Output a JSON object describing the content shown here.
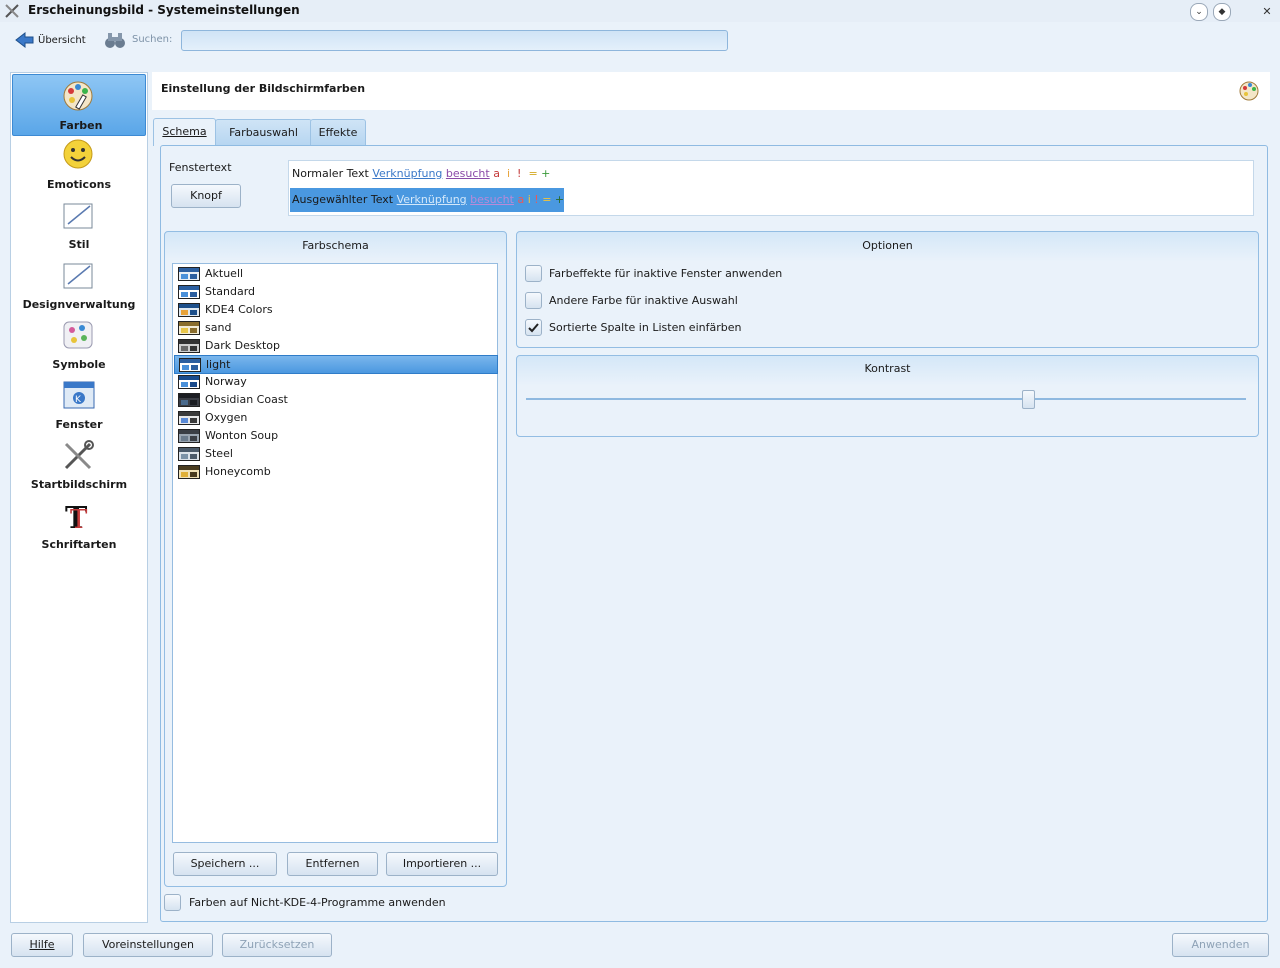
{
  "window": {
    "title": "Erscheinungsbild - Systemeinstellungen",
    "buttons": [
      "⌄",
      "◆",
      "✕"
    ]
  },
  "toolbar": {
    "back_label": "Übersicht",
    "search_label": "Suchen:",
    "search_value": ""
  },
  "sidebar": {
    "items": [
      {
        "label": "Farben",
        "icon": "palette-icon",
        "active": true
      },
      {
        "label": "Emoticons",
        "icon": "smiley-icon"
      },
      {
        "label": "Stil",
        "icon": "style-icon"
      },
      {
        "label": "Designverwaltung",
        "icon": "theme-icon"
      },
      {
        "label": "Symbole",
        "icon": "icons-icon"
      },
      {
        "label": "Fenster",
        "icon": "window-icon"
      },
      {
        "label": "Startbildschirm",
        "icon": "tools-icon"
      },
      {
        "label": "Schriftarten",
        "icon": "font-icon"
      }
    ]
  },
  "main": {
    "header_title": "Einstellung der Bildschirmfarben",
    "tabs": [
      {
        "label": "Schema",
        "active": true
      },
      {
        "label": "Farbauswahl"
      },
      {
        "label": "Effekte"
      }
    ],
    "preview": {
      "window_text": "Fenstertext",
      "button_label": "Knopf",
      "normal_text": "Normaler Text",
      "selected_text": "Ausgewählter Text",
      "link": "Verknüpfung",
      "visited": "besucht",
      "chars": [
        "a",
        "i",
        "!",
        "=",
        "+"
      ]
    },
    "scheme_group": {
      "title": "Farbschema",
      "items": [
        {
          "name": "Aktuell",
          "colors": [
            "#2c5fa0",
            "#4a90d9",
            "#e8eef5"
          ]
        },
        {
          "name": "Standard",
          "colors": [
            "#2c5fa0",
            "#4a90d9",
            "#ffffff"
          ]
        },
        {
          "name": "KDE4 Colors",
          "colors": [
            "#1d4f8a",
            "#e8a33a",
            "#dfe8f0"
          ]
        },
        {
          "name": "sand",
          "colors": [
            "#8a6d2c",
            "#e8c64a",
            "#f3ecd6"
          ]
        },
        {
          "name": "Dark Desktop",
          "colors": [
            "#333333",
            "#6a6a6a",
            "#cfcfcf"
          ]
        },
        {
          "name": "light",
          "colors": [
            "#2c5fa0",
            "#4a90d9",
            "#ffffff"
          ],
          "selected": true
        },
        {
          "name": "Norway",
          "colors": [
            "#1a4b8c",
            "#4a90d9",
            "#ffffff"
          ]
        },
        {
          "name": "Obsidian Coast",
          "colors": [
            "#1b1d22",
            "#4a6a8c",
            "#3a3d44"
          ]
        },
        {
          "name": "Oxygen",
          "colors": [
            "#3a3a3a",
            "#5a8ad6",
            "#e8e8e8"
          ]
        },
        {
          "name": "Wonton Soup",
          "colors": [
            "#3a3e45",
            "#6b7b8c",
            "#9aa5b1"
          ]
        },
        {
          "name": "Steel",
          "colors": [
            "#4b5a6a",
            "#7d93a8",
            "#dde3ea"
          ]
        },
        {
          "name": "Honeycomb",
          "colors": [
            "#4a3c20",
            "#e0b038",
            "#f0e2b8"
          ]
        }
      ],
      "buttons": {
        "save": "Speichern ...",
        "remove": "Entfernen",
        "import": "Importieren ..."
      }
    },
    "options_group": {
      "title": "Optionen",
      "items": [
        {
          "label": "Farbeffekte für inaktive Fenster anwenden",
          "checked": false
        },
        {
          "label": "Andere Farbe für inaktive Auswahl",
          "checked": false
        },
        {
          "label": "Sortierte Spalte in Listen einfärben",
          "checked": true
        }
      ]
    },
    "contrast_group": {
      "title": "Kontrast",
      "level": 0.7
    },
    "apply_non_kde_label": "Farben auf Nicht-KDE-4-Programme anwenden"
  },
  "footer": {
    "help": "Hilfe",
    "defaults": "Voreinstellungen",
    "reset": "Zurücksetzen",
    "apply": "Anwenden"
  }
}
